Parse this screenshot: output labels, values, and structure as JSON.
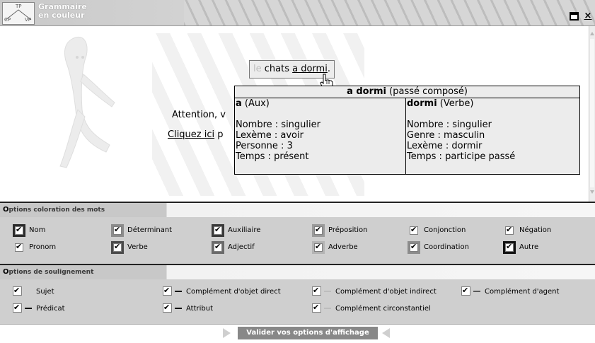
{
  "app": {
    "logo_top": "TP",
    "logo_left": "CP",
    "logo_right": "VP",
    "title_line1": "Grammaire",
    "title_line2": "en couleur"
  },
  "window_controls": {
    "maximize": "□",
    "close": "×"
  },
  "sentence": {
    "word1": "le",
    "word2": "chats",
    "word3": "a dormi",
    "punct": "."
  },
  "background_text": {
    "attention": "Attention, v",
    "click_link": "Cliquez ici",
    "click_rest": " p"
  },
  "tooltip": {
    "title_bold": "a dormi",
    "title_rest": " (passé composé)",
    "left": {
      "word": "a",
      "category": " (Aux)",
      "lines": [
        "Nombre : singulier",
        "Lexème : avoir",
        "Personne : 3",
        "Temps : présent"
      ]
    },
    "right": {
      "word": "dormi",
      "category": " (Verbe)",
      "lines": [
        "Nombre : singulier",
        "Genre : masculin",
        "Lexème : dormir",
        "Temps : participe passé"
      ]
    }
  },
  "coloration": {
    "header_initial": "O",
    "header_rest": "ptions coloration des mots",
    "options": [
      {
        "label": "Nom",
        "color": "#2a2a2a",
        "checked": true
      },
      {
        "label": "Déterminant",
        "color": "#8c8c8c",
        "checked": true
      },
      {
        "label": "Auxiliaire",
        "color": "#3a3a3a",
        "checked": true
      },
      {
        "label": "Préposition",
        "color": "#9a9a9a",
        "checked": true
      },
      {
        "label": "Conjonction",
        "color": "#cfcfcf",
        "checked": true
      },
      {
        "label": "Négation",
        "color": "#cfcfcf",
        "checked": true
      },
      {
        "label": "Pronom",
        "color": "#cfcfcf",
        "checked": true
      },
      {
        "label": "Verbe",
        "color": "#4a4a4a",
        "checked": true
      },
      {
        "label": "Adjectif",
        "color": "#6a6a6a",
        "checked": true
      },
      {
        "label": "Adverbe",
        "color": "#b4b4b4",
        "checked": true
      },
      {
        "label": "Coordination",
        "color": "#8c8c8c",
        "checked": true
      },
      {
        "label": "Autre",
        "color": "#111111",
        "checked": true
      }
    ]
  },
  "soulignement": {
    "header_initial": "O",
    "header_rest": "ptions de soulignement",
    "options": [
      {
        "label": "Sujet",
        "color": "#cfcfcf"
      },
      {
        "label": "Complément d'objet direct",
        "color": "#000000"
      },
      {
        "label": "Complément d'objet indirect",
        "color": "#bdbdbd"
      },
      {
        "label": "Complément d'agent",
        "color": "#5a5a5a"
      },
      {
        "label": "Prédicat",
        "color": "#000000"
      },
      {
        "label": "Attribut",
        "color": "#000000"
      },
      {
        "label": "Complément circonstantiel",
        "color": "#bdbdbd"
      }
    ]
  },
  "footer": {
    "validate": "Valider vos options d'affichage"
  }
}
